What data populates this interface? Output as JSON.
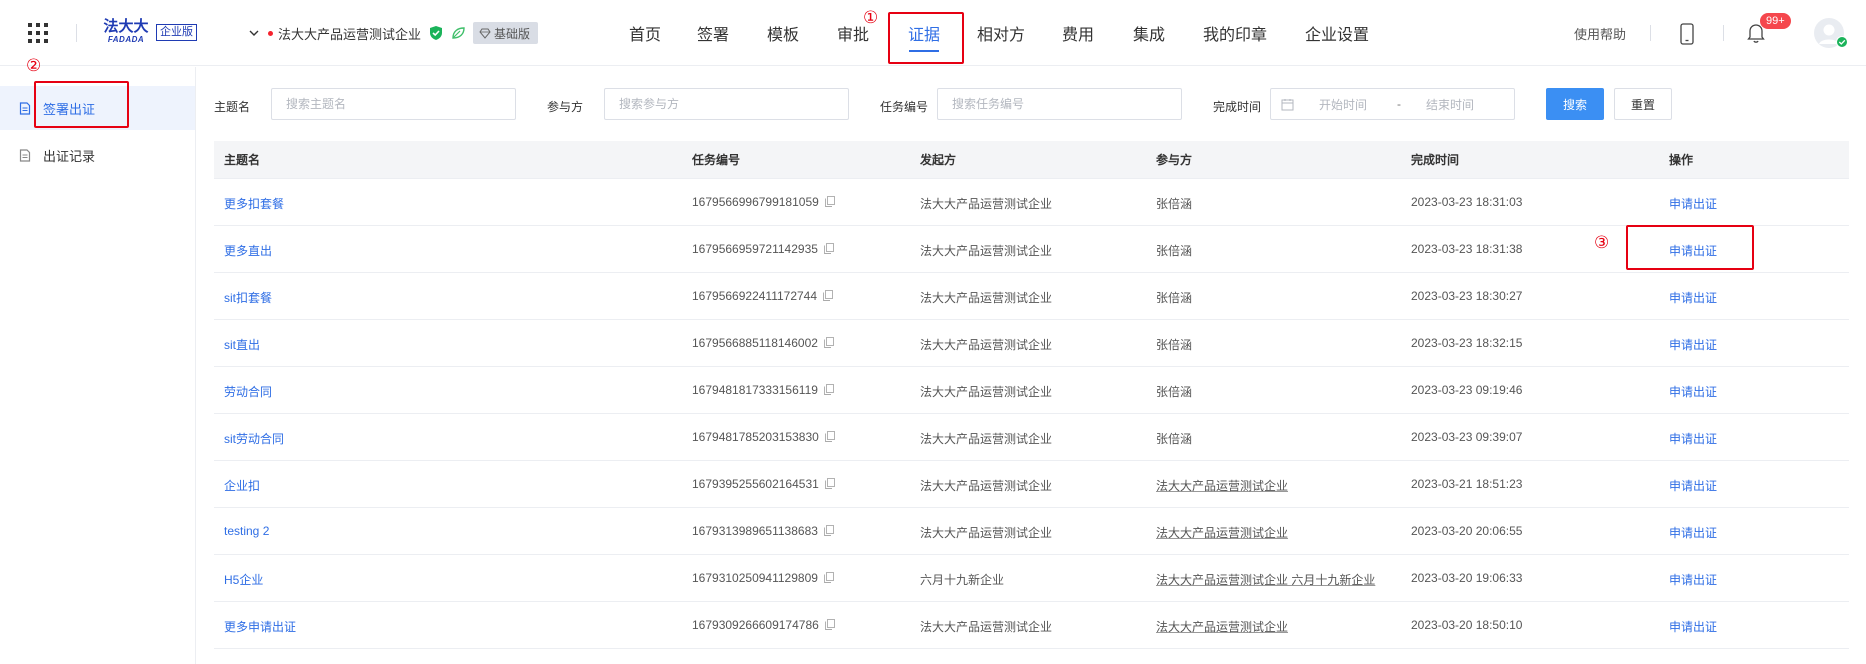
{
  "header": {
    "logo": {
      "cn": "法大大",
      "en": "FADADA",
      "edition": "企业版"
    },
    "company": {
      "name": "法大大产品运营测试企业",
      "plan": "基础版"
    },
    "nav": [
      {
        "label": "首页",
        "active": false
      },
      {
        "label": "签署",
        "active": false
      },
      {
        "label": "模板",
        "active": false
      },
      {
        "label": "审批",
        "active": false
      },
      {
        "label": "证据",
        "active": true
      },
      {
        "label": "相对方",
        "active": false
      },
      {
        "label": "费用",
        "active": false
      },
      {
        "label": "集成",
        "active": false
      },
      {
        "label": "我的印章",
        "active": false
      },
      {
        "label": "企业设置",
        "active": false
      }
    ],
    "help_label": "使用帮助",
    "notification_count": "99+"
  },
  "sidebar": {
    "items": [
      {
        "label": "签署出证",
        "icon": "document-icon",
        "active": true
      },
      {
        "label": "出证记录",
        "icon": "record-icon",
        "active": false
      }
    ]
  },
  "filters": {
    "subject": {
      "label": "主题名",
      "placeholder": "搜索主题名",
      "value": ""
    },
    "participant": {
      "label": "参与方",
      "placeholder": "搜索参与方",
      "value": ""
    },
    "task_id": {
      "label": "任务编号",
      "placeholder": "搜索任务编号",
      "value": ""
    },
    "completion_time": {
      "label": "完成时间",
      "start_placeholder": "开始时间",
      "separator": "-",
      "end_placeholder": "结束时间"
    },
    "search_label": "搜索",
    "reset_label": "重置"
  },
  "table": {
    "columns": [
      "主题名",
      "任务编号",
      "发起方",
      "参与方",
      "完成时间",
      "操作"
    ],
    "rows": [
      {
        "subject": "更多扣套餐",
        "task_id": "1679566996799181059",
        "initiator": "法大大产品运营测试企业",
        "participant": "张倍涵",
        "time": "2023-03-23 18:31:03",
        "action": "申请出证"
      },
      {
        "subject": "更多直出",
        "task_id": "1679566959721142935",
        "initiator": "法大大产品运营测试企业",
        "participant": "张倍涵",
        "time": "2023-03-23 18:31:38",
        "action": "申请出证"
      },
      {
        "subject": "sit扣套餐",
        "task_id": "1679566922411172744",
        "initiator": "法大大产品运营测试企业",
        "participant": "张倍涵",
        "time": "2023-03-23 18:30:27",
        "action": "申请出证"
      },
      {
        "subject": "sit直出",
        "task_id": "1679566885118146002",
        "initiator": "法大大产品运营测试企业",
        "participant": "张倍涵",
        "time": "2023-03-23 18:32:15",
        "action": "申请出证"
      },
      {
        "subject": "劳动合同",
        "task_id": "1679481817333156119",
        "initiator": "法大大产品运营测试企业",
        "participant": "张倍涵",
        "time": "2023-03-23 09:19:46",
        "action": "申请出证"
      },
      {
        "subject": "sit劳动合同",
        "task_id": "1679481785203153830",
        "initiator": "法大大产品运营测试企业",
        "participant": "张倍涵",
        "time": "2023-03-23 09:39:07",
        "action": "申请出证"
      },
      {
        "subject": "企业扣",
        "task_id": "1679395255602164531",
        "initiator": "法大大产品运营测试企业",
        "participant": "法大大产品运营测试企业",
        "time": "2023-03-21 18:51:23",
        "action": "申请出证"
      },
      {
        "subject": "testing 2",
        "task_id": "1679313989651138683",
        "initiator": "法大大产品运营测试企业",
        "participant": "法大大产品运营测试企业",
        "time": "2023-03-20 20:06:55",
        "action": "申请出证"
      },
      {
        "subject": "H5企业",
        "task_id": "1679310250941129809",
        "initiator": "六月十九新企业",
        "participant": "法大大产品运营测试企业 六月十九新企业",
        "time": "2023-03-20 19:06:33",
        "action": "申请出证"
      },
      {
        "subject": "更多申请出证",
        "task_id": "1679309266609174786",
        "initiator": "法大大产品运营测试企业",
        "participant": "法大大产品运营测试企业",
        "time": "2023-03-20 18:50:10",
        "action": "申请出证"
      }
    ]
  },
  "annotations": [
    "①",
    "②",
    "③"
  ],
  "colors": {
    "accent": "#2f6ee5",
    "primary_button": "#3b8ff3",
    "annotation": "#e60012",
    "badge": "#f5474d"
  }
}
